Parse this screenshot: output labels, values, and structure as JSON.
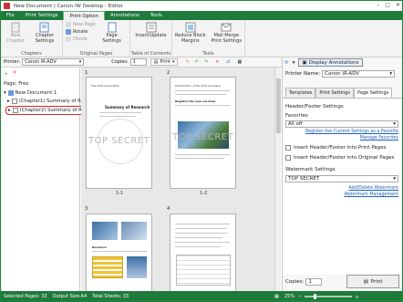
{
  "window": {
    "title": "New Document | Canon iW Desktop - Editor"
  },
  "ribbon_tabs": [
    "File",
    "Print Settings",
    "Print Option",
    "Annotations",
    "Tools"
  ],
  "ribbon": {
    "new_chapter": "New Chapter",
    "chapter_settings": "Chapter Settings",
    "new_page": "New Page",
    "rotate": "Rotate",
    "divide": "Divide",
    "page_settings": "Page Settings",
    "insert_update": "Insert/Update",
    "reduce_block_margins": "Reduce Block Margins",
    "mail_merge": "Mail Merge Print Settings",
    "groups": {
      "chapters": "Chapters",
      "original_pages": "Original Pages",
      "toc": "Table of Contents",
      "tools": "Tools"
    }
  },
  "toolbar": {
    "printer_label": "Printer:",
    "printer_value": "Canon iR-ADV",
    "copies_label": "Copies:",
    "copies_value": "1",
    "print_label": "Print"
  },
  "display_annotations": "Display Annotations",
  "left": {
    "page_label": "Page:",
    "page_value": "Free",
    "tree": [
      "New Document 1",
      "(Chapter1) Summary of R",
      "(Chapter2) Summary of R"
    ]
  },
  "pages": [
    {
      "num": "1",
      "label": "1-1",
      "heading": "The XYZ Corporation",
      "title": "Summary of Research",
      "watermark": "TOP SECRET"
    },
    {
      "num": "2",
      "label": "1-2",
      "heading": "Introduction of the XYZ Company",
      "title": "Register the new vaccines",
      "watermark": "TOP SECRET"
    },
    {
      "num": "3",
      "label": "",
      "heading": "Research",
      "watermark": ""
    },
    {
      "num": "4",
      "label": "",
      "heading": "",
      "watermark": ""
    }
  ],
  "right": {
    "printer_name_label": "Printer Name:",
    "printer_name_value": "Canon iR-ADV",
    "tabs": [
      "Templates",
      "Print Settings",
      "Page Settings"
    ],
    "header_footer_title": "Header/Footer Settings",
    "favorites_label": "Favorites",
    "favorites_value": "All off",
    "register_link": "Register the Current Settings as a Favorite",
    "manage_link": "Manage Favorites",
    "chk_print": "Insert Header/Footer into Print Pages",
    "chk_original": "Insert Header/Footer into Original Pages",
    "watermark_title": "Watermark Settings",
    "watermark_value": "TOP SECRET",
    "add_delete_link": "Add/Delete Watermark",
    "wm_manage_link": "Watermark Management",
    "copies_label": "Copies:",
    "copies_value": "1",
    "print_button": "Print"
  },
  "status": {
    "selected_pages": "Selected Pages: 33",
    "output_size": "Output Size:A4",
    "total_sheets": "Total Sheets: 33",
    "zoom": "25%"
  },
  "colors": {
    "accent_green": "#1f7a3c",
    "highlight_red": "#e02020"
  }
}
